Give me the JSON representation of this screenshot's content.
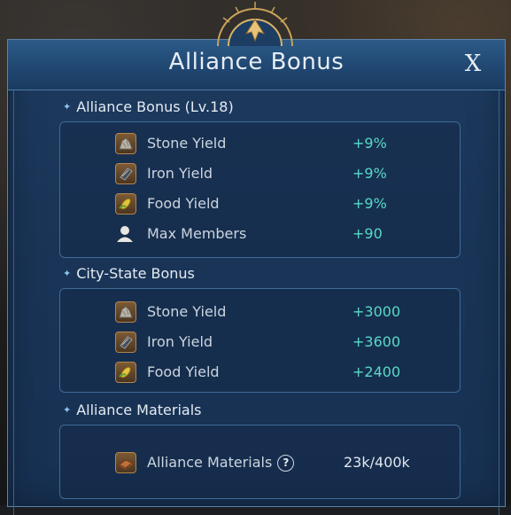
{
  "window": {
    "title": "Alliance Bonus",
    "close_label": "X"
  },
  "sections": [
    {
      "title": "Alliance Bonus (Lv.18)",
      "rows": [
        {
          "icon": "stone-icon",
          "label": "Stone Yield",
          "value": "+9%"
        },
        {
          "icon": "iron-icon",
          "label": "Iron Yield",
          "value": "+9%"
        },
        {
          "icon": "food-icon",
          "label": "Food Yield",
          "value": "+9%"
        },
        {
          "icon": "member-icon",
          "label": "Max Members",
          "value": "+90"
        }
      ]
    },
    {
      "title": "City-State Bonus",
      "rows": [
        {
          "icon": "stone-icon",
          "label": "Stone Yield",
          "value": "+3000"
        },
        {
          "icon": "iron-icon",
          "label": "Iron Yield",
          "value": "+3600"
        },
        {
          "icon": "food-icon",
          "label": "Food Yield",
          "value": "+2400"
        }
      ]
    },
    {
      "title": "Alliance Materials",
      "rows": [
        {
          "icon": "alliance-materials-icon",
          "label": "Alliance Materials",
          "help": "?",
          "value": "23k/400k"
        }
      ]
    }
  ],
  "colors": {
    "panel": "#1a3558",
    "bonus_value": "#58d9c6",
    "border": "#3d6b97"
  }
}
